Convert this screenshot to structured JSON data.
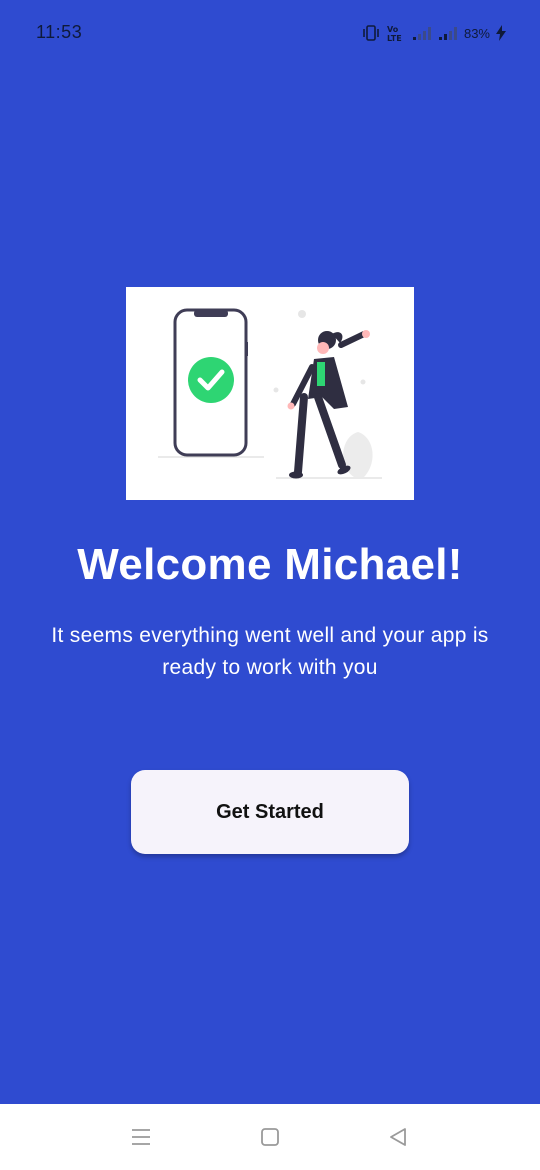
{
  "status_bar": {
    "time": "11:53",
    "network_label": "VoLTE",
    "battery_percent": "83%",
    "icons": [
      "vibrate-icon",
      "volte-icon",
      "signal-icon",
      "signal-icon",
      "battery-charging-icon"
    ]
  },
  "illustration": {
    "description_icon": "phone-check-woman-illustration",
    "check_color": "#2ed573"
  },
  "welcome": {
    "title": "Welcome Michael!",
    "subtitle": "It seems everything went well and your app is ready to work with you"
  },
  "cta": {
    "label": "Get Started"
  },
  "navigation": {
    "icons": [
      "menu-icon",
      "home-square-icon",
      "back-triangle-icon"
    ]
  },
  "colors": {
    "background": "#2f4bd0",
    "button": "#f6f3fb",
    "text_light": "#ffffff",
    "text_dark": "#111111"
  }
}
